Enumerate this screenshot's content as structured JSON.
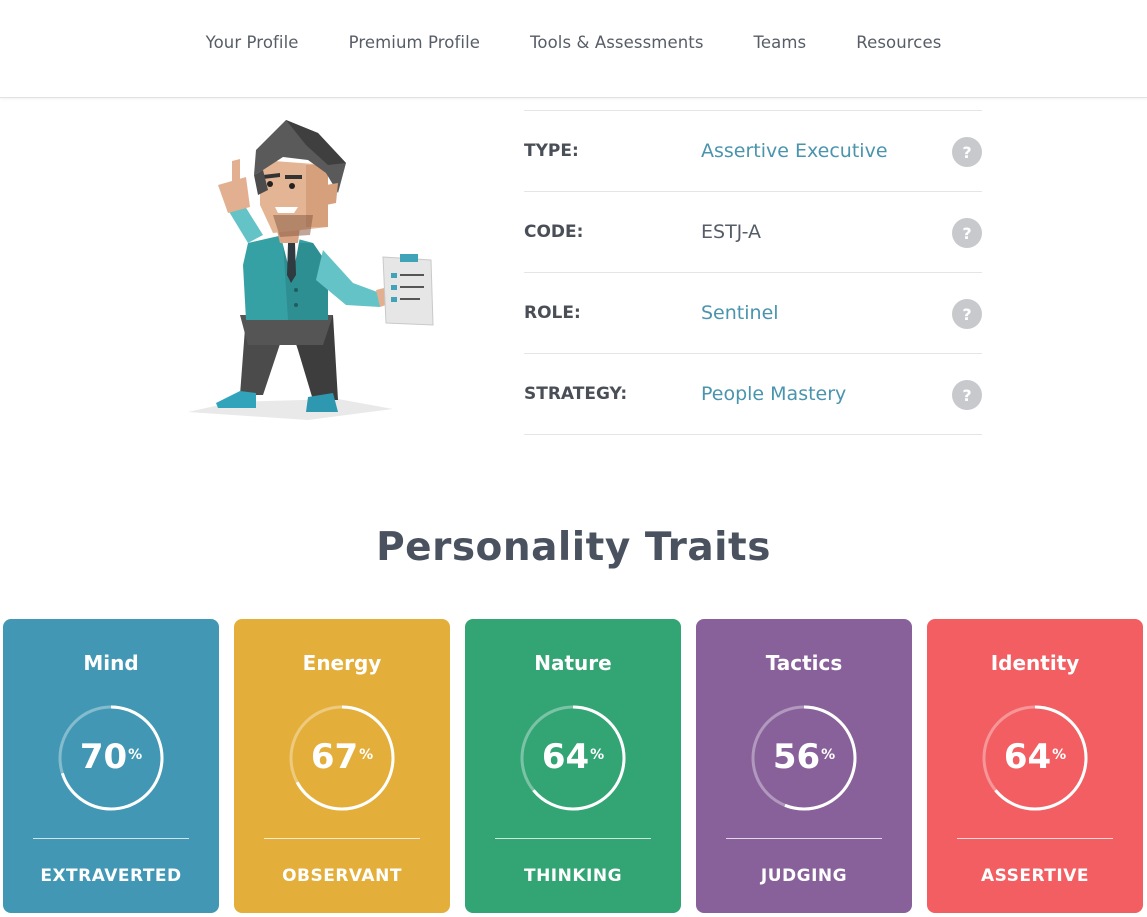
{
  "nav": {
    "items": [
      {
        "label": "Your Profile"
      },
      {
        "label": "Premium Profile"
      },
      {
        "label": "Tools & Assessments"
      },
      {
        "label": "Teams"
      },
      {
        "label": "Resources"
      }
    ]
  },
  "profile": {
    "avatar_icon": "executive-character-illustration",
    "rows": [
      {
        "label": "TYPE:",
        "value": "Assertive Executive"
      },
      {
        "label": "CODE:",
        "value": "ESTJ-A"
      },
      {
        "label": "ROLE:",
        "value": "Sentinel"
      },
      {
        "label": "STRATEGY:",
        "value": "People Mastery"
      }
    ],
    "help_glyph": "?"
  },
  "traits": {
    "title": "Personality Traits",
    "percent_sign": "%",
    "cards": [
      {
        "name": "Mind",
        "percent": 70,
        "trait": "EXTRAVERTED",
        "color": "#4298b4"
      },
      {
        "name": "Energy",
        "percent": 67,
        "trait": "OBSERVANT",
        "color": "#e4ae3a"
      },
      {
        "name": "Nature",
        "percent": 64,
        "trait": "THINKING",
        "color": "#33a474"
      },
      {
        "name": "Tactics",
        "percent": 56,
        "trait": "JUDGING",
        "color": "#88619a"
      },
      {
        "name": "Identity",
        "percent": 64,
        "trait": "ASSERTIVE",
        "color": "#f25e62"
      }
    ]
  }
}
